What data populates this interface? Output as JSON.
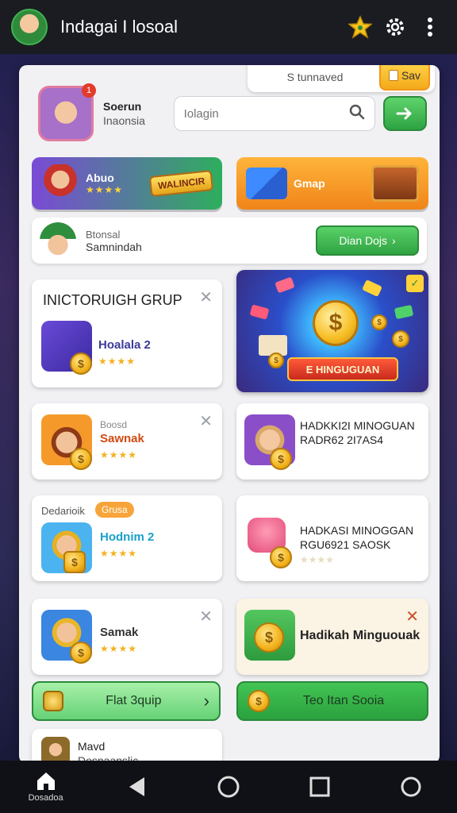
{
  "header": {
    "title": "Indagai I losoal",
    "icons": [
      "star-icon",
      "gear-icon",
      "more-vertical-icon"
    ]
  },
  "tabs": {
    "left": "S tunnaved",
    "right": "Sav"
  },
  "profile": {
    "name": "Soerun",
    "subtitle": "Inaonsia",
    "badge": "1"
  },
  "search": {
    "placeholder": "Iolagin"
  },
  "feature_buttons": {
    "left": {
      "label": "Abuo",
      "stars": "★★★★",
      "badge": "WALINCIR"
    },
    "right": {
      "label": "Gmap"
    }
  },
  "notice": {
    "line1": "Btonsal",
    "line2": "Samnindah",
    "cta": "Dian Dojs"
  },
  "group_card": {
    "title": "INICTORUIGH GRUP",
    "game": "Hoalala 2",
    "stars": "★★★★"
  },
  "promo": {
    "ribbon": "E HINGUGUAN"
  },
  "cards": [
    {
      "small": "Boosd",
      "name": "Sawnak",
      "stars": "★★★★"
    },
    {
      "title1": "HADKKI2I MINOGUAN",
      "title2": "RADR62 2I7AS4"
    },
    {
      "tag_left": "Dedarioik",
      "tag_right": "Grusa",
      "name": "Hodnim 2",
      "stars": "★★★★"
    },
    {
      "title1": "HADKASI MINOGGAN",
      "title2": "RGU6921 SAOSK"
    },
    {
      "name": "Samak",
      "stars": "★★★★"
    },
    {
      "title": "Hadikah Minguouak"
    }
  ],
  "action_buttons": {
    "left": "Flat 3quip",
    "right": "Teo Itan Sooia"
  },
  "bottom_card": {
    "line1": "Mavd",
    "line2": "Dosnaanslic"
  },
  "nav": {
    "home_label": "Dosadoa"
  },
  "colors": {
    "accent_green": "#2ea343",
    "accent_orange": "#f0841a",
    "header_bg": "#1a1c22"
  }
}
